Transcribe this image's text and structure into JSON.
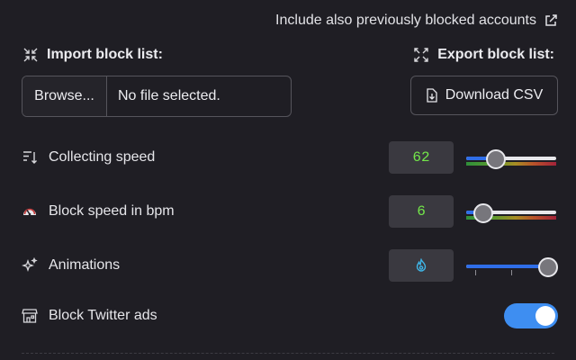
{
  "top_link": {
    "label": "Include also previously blocked accounts",
    "icon": "external-link-icon"
  },
  "import": {
    "label": "Import block list:",
    "icon": "collapse-arrows-icon",
    "browse_label": "Browse...",
    "file_status": "No file selected."
  },
  "export": {
    "label": "Export block list:",
    "icon": "expand-arrows-icon",
    "download_label": "Download CSV",
    "download_icon": "file-download-icon"
  },
  "settings": [
    {
      "label": "Collecting speed",
      "icon": "sort-down-icon",
      "value": "62",
      "slider_fraction": 0.32
    },
    {
      "label": "Block speed in bpm",
      "icon": "speedometer-icon",
      "value": "6",
      "slider_fraction": 0.18
    },
    {
      "label": "Animations",
      "icon": "sparkles-icon",
      "value_icon": "flame-icon",
      "slider_fraction": 0.9
    },
    {
      "label": "Block Twitter ads",
      "icon": "storefront-icon",
      "toggle_on": true
    }
  ],
  "colors": {
    "background": "#1f1e24",
    "accent": "#2f6ee8",
    "value_text": "#73e64a",
    "toggle_on": "#3e8ef1"
  }
}
